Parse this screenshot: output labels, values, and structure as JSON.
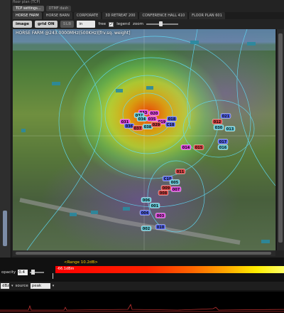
{
  "window": {
    "title": "floor plan (TCP)"
  },
  "topbar": {
    "buttons": [
      "TCP settings...",
      "DTMF dash"
    ]
  },
  "tabs": [
    "HORSE FARM",
    "HORSE BARN",
    "CORPORATE",
    "3D RETREAT 200",
    "CONFERENCE HALL 410",
    "FLOOR PLAN 601"
  ],
  "toolbar": {
    "image_label": "image",
    "grid_label": "grid ON",
    "disabled_label": "SLB",
    "unit_value": "in",
    "free_label": "free",
    "legend_checked": "✓",
    "legend_label": "legend",
    "zoom_label": "zoom"
  },
  "map": {
    "title": "HORSE FARM @243.0000MHz(500KHz)[frv.sq. weight]",
    "nodes": [
      {
        "id": "033",
        "color": "#e040e0"
      },
      {
        "id": "032",
        "color": "#5fc8d8"
      },
      {
        "id": "020",
        "color": "#e040e0"
      },
      {
        "id": "035",
        "color": "#e040e0"
      },
      {
        "id": "034",
        "color": "#5fc8d8"
      },
      {
        "id": "031",
        "color": "#e040e0"
      },
      {
        "id": "036",
        "color": "#5060e8"
      },
      {
        "id": "037",
        "color": "#d84040"
      },
      {
        "id": "038",
        "color": "#5fc8d8"
      },
      {
        "id": "019",
        "color": "#e040e0"
      },
      {
        "id": "018",
        "color": "#5060e8"
      },
      {
        "id": "029",
        "color": "#d84040"
      },
      {
        "id": "C18",
        "color": "#5060e8"
      },
      {
        "id": "021",
        "color": "#5060e8"
      },
      {
        "id": "012",
        "color": "#d84040"
      },
      {
        "id": "030",
        "color": "#5fc8d8"
      },
      {
        "id": "013",
        "color": "#5fc8d8"
      },
      {
        "id": "017",
        "color": "#5060e8"
      },
      {
        "id": "014",
        "color": "#e040e0"
      },
      {
        "id": "015",
        "color": "#d84040"
      },
      {
        "id": "016",
        "color": "#5fc8d8"
      },
      {
        "id": "011",
        "color": "#d84040"
      },
      {
        "id": "C10",
        "color": "#5060e8"
      },
      {
        "id": "005",
        "color": "#5fc8d8"
      },
      {
        "id": "007",
        "color": "#e040e0"
      },
      {
        "id": "009",
        "color": "#d84040"
      },
      {
        "id": "008",
        "color": "#d84040"
      },
      {
        "id": "006",
        "color": "#5fc8d8"
      },
      {
        "id": "001",
        "color": "#5fc8d8"
      },
      {
        "id": "004",
        "color": "#5060e8"
      },
      {
        "id": "003",
        "color": "#e040e0"
      },
      {
        "id": "002",
        "color": "#5fc8d8"
      },
      {
        "id": "010",
        "color": "#5060e8"
      }
    ]
  },
  "legend": {
    "range_text": "<Range 10.2dB>",
    "grad_low": "-66.1dBm",
    "opacity_label": "opacity",
    "opacity_value": "0.4"
  },
  "bottom": {
    "left_value": "dBz",
    "source_label": "source",
    "source_value": "peak"
  }
}
